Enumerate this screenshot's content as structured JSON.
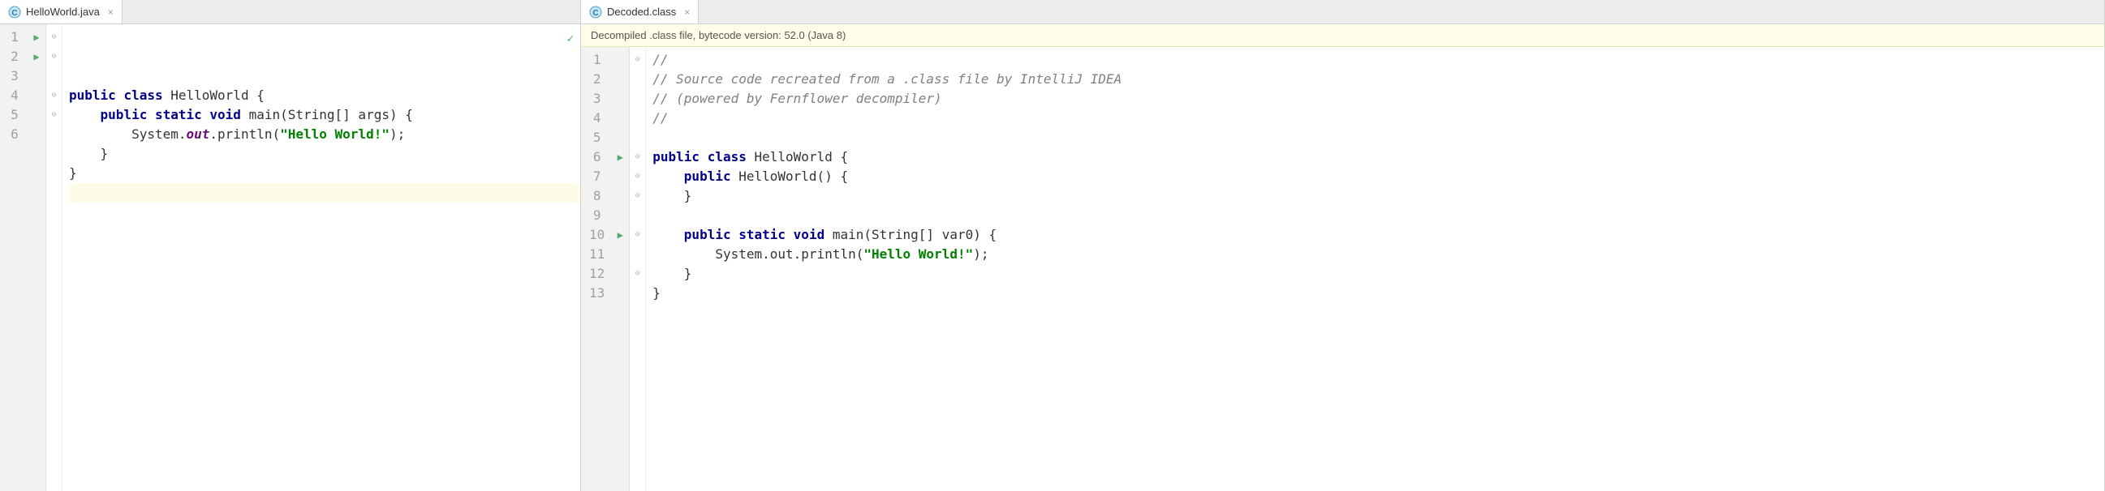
{
  "left": {
    "tab": {
      "icon": "class-icon",
      "label": "HelloWorld.java"
    },
    "lines": [
      1,
      2,
      3,
      4,
      5,
      6
    ],
    "runLines": [
      1,
      2
    ],
    "foldLines": {
      "1": "open",
      "2": "open",
      "4": "close",
      "5": "close"
    },
    "currentLine": 6,
    "code": {
      "l1": {
        "indent": "",
        "kw1": "public",
        "kw2": "class",
        "name": "HelloWorld",
        "tail": " {"
      },
      "l2": {
        "indent": "    ",
        "kw1": "public",
        "kw2": "static",
        "kw3": "void",
        "name": "main",
        "params": "(String[] args) {"
      },
      "l3": {
        "indent": "        ",
        "pre": "System.",
        "field": "out",
        "mid": ".println(",
        "str": "\"Hello World!\"",
        "post": ");"
      },
      "l4": {
        "text": "    }"
      },
      "l5": {
        "text": "}"
      },
      "l6": {
        "text": ""
      }
    }
  },
  "right": {
    "tab": {
      "icon": "class-icon",
      "label": "Decoded.class"
    },
    "banner": "Decompiled .class file, bytecode version: 52.0 (Java 8)",
    "lines": [
      1,
      2,
      3,
      4,
      5,
      6,
      7,
      8,
      9,
      10,
      11,
      12,
      13
    ],
    "runLines": [
      6,
      10
    ],
    "foldLines": {
      "1": "open",
      "6": "open",
      "7": "open",
      "8": "close",
      "10": "open",
      "12": "close"
    },
    "code": {
      "l1": {
        "comment": "//"
      },
      "l2": {
        "comment": "// Source code recreated from a .class file by IntelliJ IDEA"
      },
      "l3": {
        "comment": "// (powered by Fernflower decompiler)"
      },
      "l4": {
        "comment": "//"
      },
      "l5": {
        "text": ""
      },
      "l6": {
        "kw1": "public",
        "kw2": "class",
        "name": "HelloWorld",
        "tail": " {"
      },
      "l7": {
        "indent": "    ",
        "kw1": "public",
        "name": "HelloWorld",
        "params": "() {"
      },
      "l8": {
        "text": "    }"
      },
      "l9": {
        "text": ""
      },
      "l10": {
        "indent": "    ",
        "kw1": "public",
        "kw2": "static",
        "kw3": "void",
        "name": "main",
        "params": "(String[] var0) {"
      },
      "l11": {
        "indent": "        ",
        "pre": "System.out.println(",
        "str": "\"Hello World!\"",
        "post": ");"
      },
      "l12": {
        "text": "    }"
      },
      "l13": {
        "text": "}"
      }
    }
  }
}
